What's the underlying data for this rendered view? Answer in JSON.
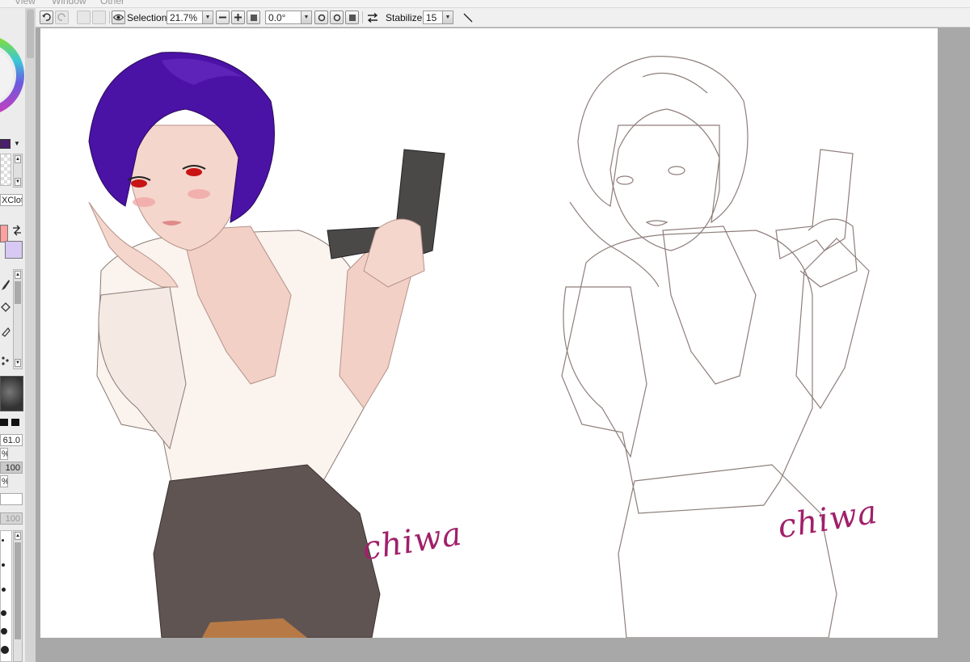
{
  "menubar": {
    "items": [
      "View",
      "Window",
      "Other"
    ]
  },
  "toolbar": {
    "selection_label": "Selection",
    "zoom_value": "21.7%",
    "rotation_value": "0.0°",
    "stabilizer_label": "Stabilizer",
    "stabilizer_value": "15"
  },
  "left_panel": {
    "brush_name": "XClot...",
    "size_value": "61.0",
    "percent_1": "%",
    "percent_2": "%",
    "opacity_value": "100",
    "density_value": "100"
  },
  "canvas": {
    "signature_left": "chiwa",
    "signature_right": "chiwa"
  },
  "colors": {
    "primary": "#ff9f9f",
    "secondary": "#d8c8f4",
    "hair": "#4b12a6",
    "signature": "#a0206a"
  }
}
